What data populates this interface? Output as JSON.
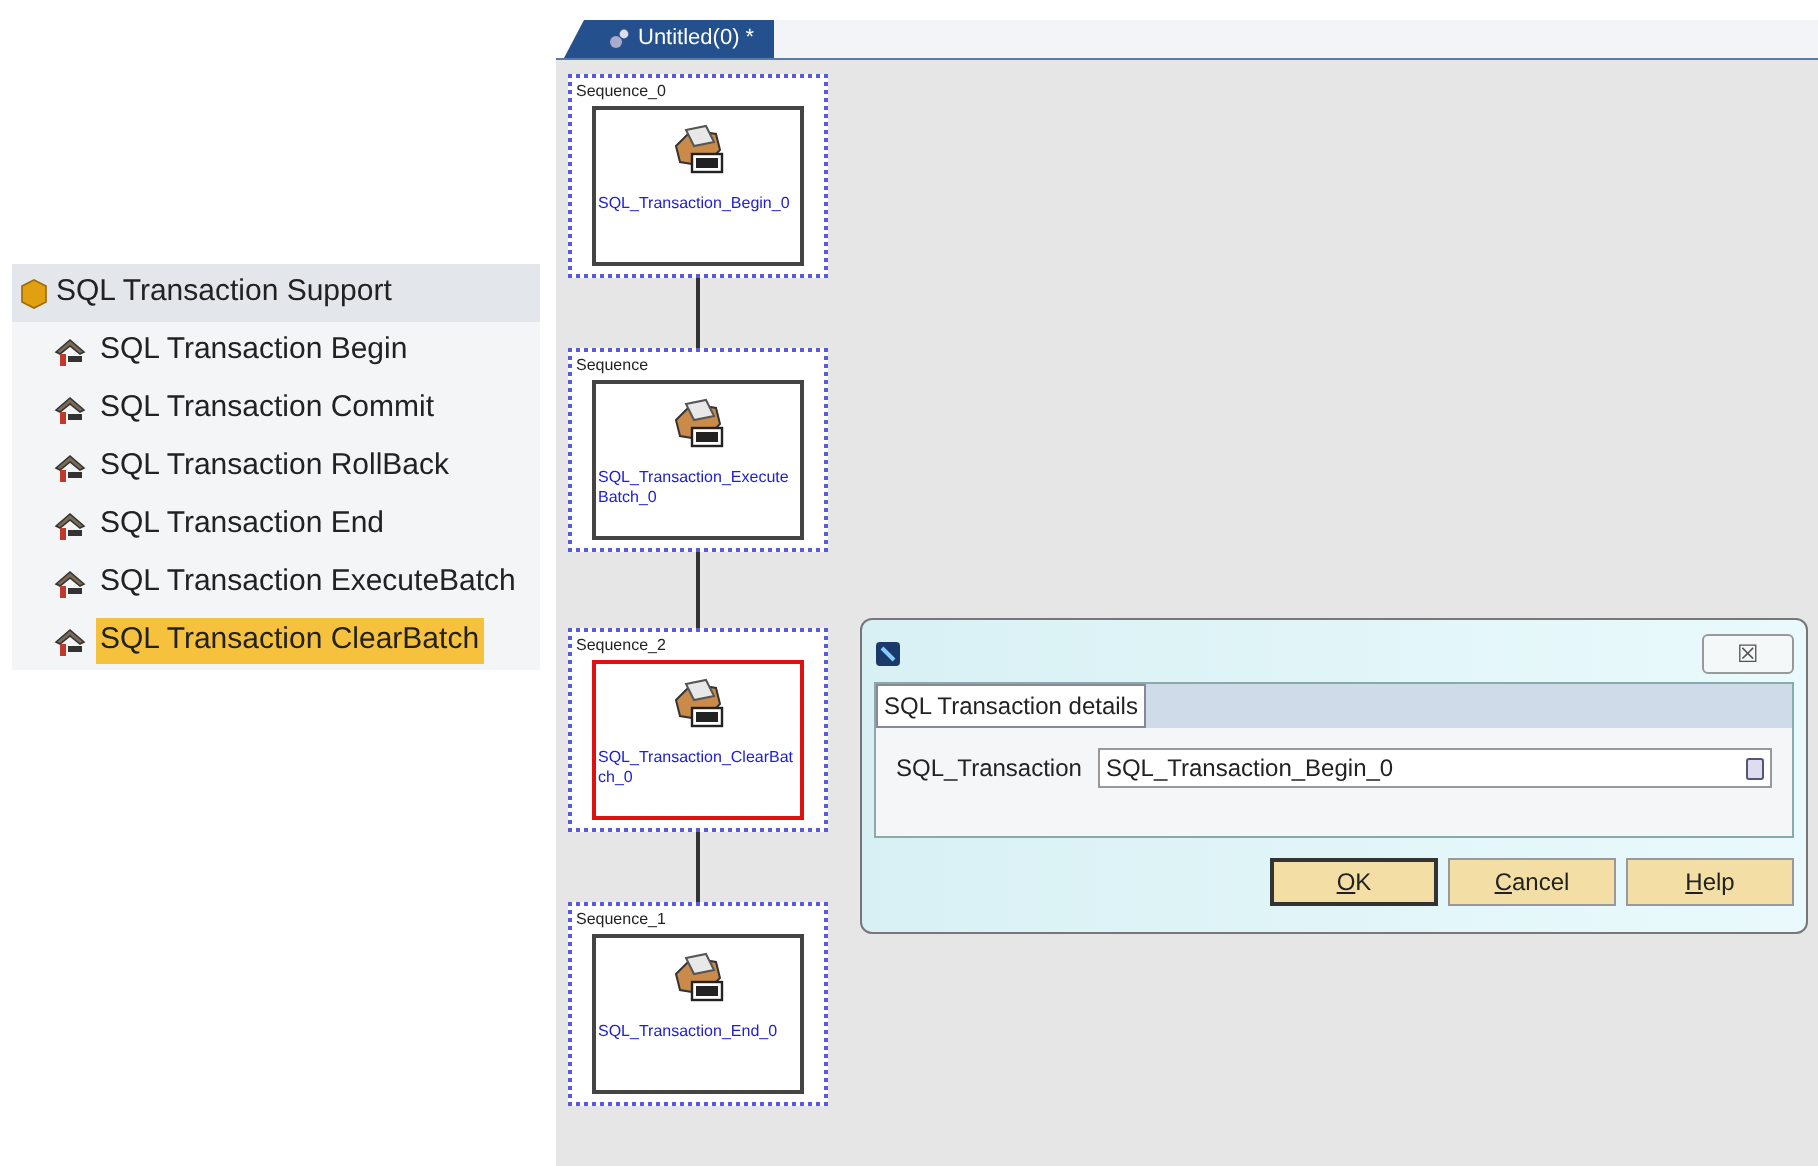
{
  "palette": {
    "group": "SQL Transaction Support",
    "items": [
      {
        "label": "SQL Transaction Begin",
        "selected": false
      },
      {
        "label": "SQL Transaction Commit",
        "selected": false
      },
      {
        "label": "SQL Transaction RollBack",
        "selected": false
      },
      {
        "label": "SQL Transaction End",
        "selected": false
      },
      {
        "label": "SQL Transaction ExecuteBatch",
        "selected": false
      },
      {
        "label": "SQL Transaction ClearBatch",
        "selected": true
      }
    ]
  },
  "editor_tab": {
    "title": "Untitled(0) *",
    "selected": true
  },
  "flow": [
    {
      "sequence": "Sequence_0",
      "action": "SQL_Transaction_Begin_0",
      "selected": false
    },
    {
      "sequence": "Sequence",
      "action": "SQL_Transaction_ExecuteBatch_0",
      "selected": false
    },
    {
      "sequence": "Sequence_2",
      "action": "SQL_Transaction_ClearBatch_0",
      "selected": true
    },
    {
      "sequence": "Sequence_1",
      "action": "SQL_Transaction_End_0",
      "selected": false
    }
  ],
  "dialog": {
    "close": "☒",
    "group_title": "SQL Transaction details",
    "field_label": "SQL_Transaction",
    "field_value": "SQL_Transaction_Begin_0",
    "buttons": [
      {
        "label": "OK",
        "default": true
      },
      {
        "label": "Cancel",
        "default": false
      },
      {
        "label": "Help",
        "default": false
      }
    ]
  }
}
